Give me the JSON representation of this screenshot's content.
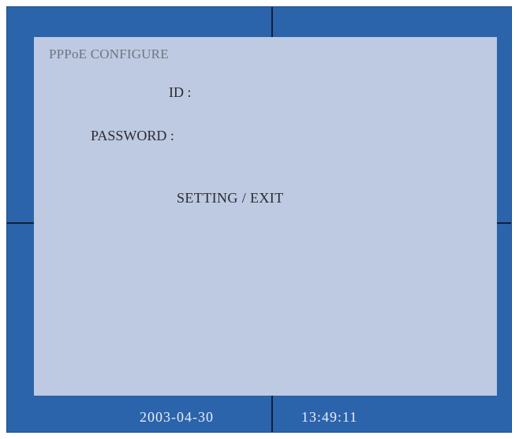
{
  "menu": {
    "title": "PPPoE CONFIGURE",
    "id_label": "ID :",
    "id_value": "",
    "password_label": "PASSWORD :",
    "password_value": "",
    "setting_label": "SETTING",
    "separator": "/",
    "exit_label": "EXIT"
  },
  "status": {
    "date": "2003-04-30",
    "time": "13:49:11"
  },
  "colors": {
    "background": "#2b64ab",
    "panel": "#bec9e2",
    "grid_line": "#10203a"
  }
}
